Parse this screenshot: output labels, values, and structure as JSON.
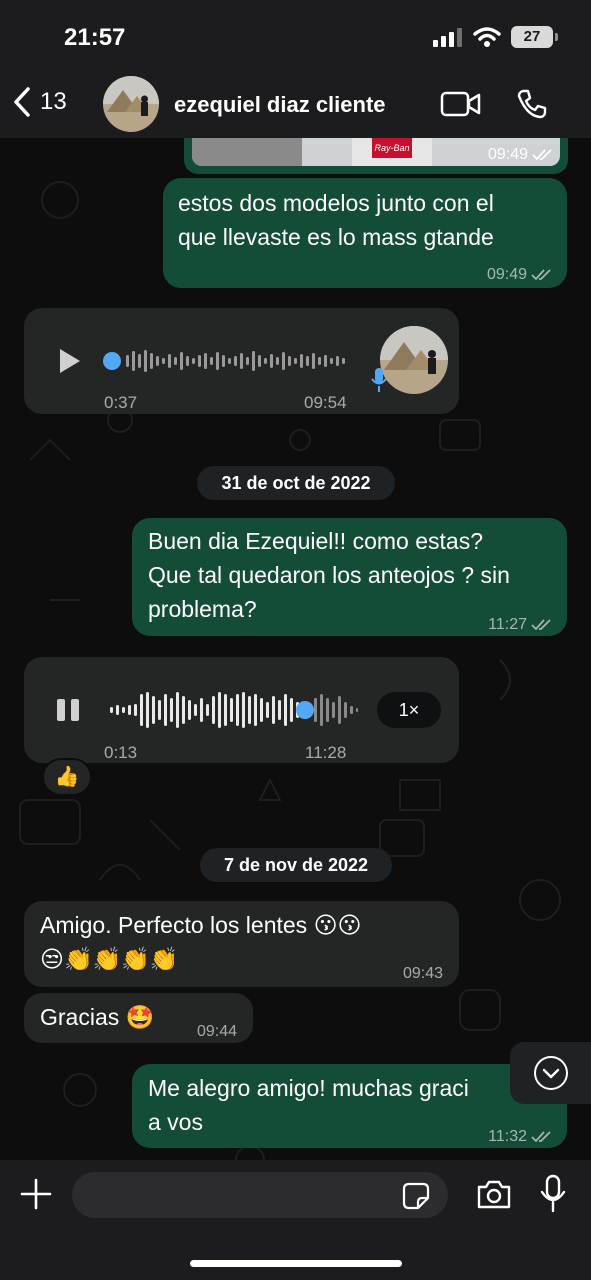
{
  "status_bar": {
    "time": "21:57",
    "battery": "27"
  },
  "header": {
    "back_count": "13",
    "contact_name": "ezequiel diaz cliente"
  },
  "messages": [
    {
      "time": "09:49"
    },
    {
      "text": "estos dos modelos junto con el\nque llevaste es lo mass gtande",
      "time": "09:49"
    },
    {
      "duration": "0:37",
      "time": "09:54"
    },
    {
      "date": "31 de oct de 2022"
    },
    {
      "text": "Buen dia Ezequiel!! como estas?\nQue tal quedaron los anteojos ? sin\nproblema?",
      "time": "11:27"
    },
    {
      "duration": "0:13",
      "time": "11:28",
      "speed": "1×",
      "reaction": "👍"
    },
    {
      "date": "7 de nov de 2022"
    },
    {
      "text": "Amigo. Perfecto los lentes 😗😗\n😒👏👏👏👏",
      "time": "09:43"
    },
    {
      "text": "Gracias 🤩",
      "time": "09:44"
    },
    {
      "text": "Me alegro amigo! muchas graci\na vos",
      "time": "11:32"
    }
  ],
  "photo_thumb": {
    "brand": "Ray-Ban"
  },
  "input": {
    "placeholder": ""
  },
  "colors": {
    "outgoing": "#144d37",
    "incoming": "#242626",
    "accent": "#53a8f6"
  }
}
